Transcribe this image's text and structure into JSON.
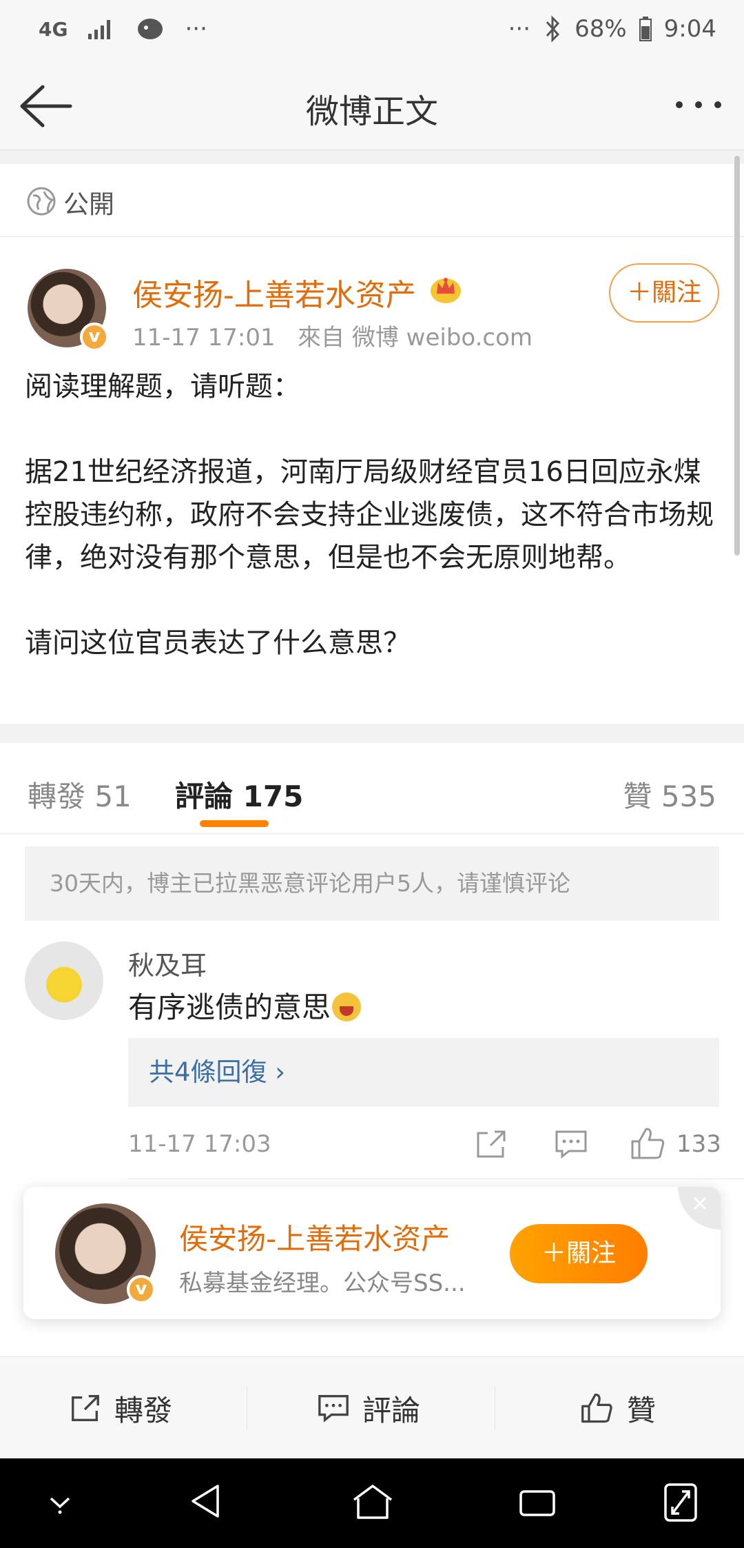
{
  "status_bar": {
    "network": "4G",
    "more_left": "···",
    "more_right": "···",
    "battery": "68%",
    "time": "9:04"
  },
  "nav": {
    "title": "微博正文"
  },
  "visibility": {
    "label": "公開"
  },
  "post": {
    "author": "侯安扬-上善若水资产",
    "verified_badge": "v",
    "timestamp": "11-17 17:01",
    "source": "來自 微博 weibo.com",
    "follow_label": "＋關注",
    "body": "阅读理解题，请听题：\n\n据21世纪经济报道，河南厅局级财经官员16日回应永煤控股违约称，政府不会支持企业逃废债，这不符合市场规律，绝对没有那个意思，但是也不会无原则地帮。\n\n请问这位官员表达了什么意思？"
  },
  "tabs": {
    "repost": "轉發 51",
    "comment": "評論 175",
    "like": "贊 535"
  },
  "comments": {
    "notice": "30天内，博主已拉黑恶意评论用户5人，请谨慎评论",
    "items": [
      {
        "name": "秋及耳",
        "text": "有序逃债的意思",
        "replies": "共4條回復 ›",
        "time": "11-17 17:03",
        "likes": "133"
      }
    ]
  },
  "follow_card": {
    "name": "侯安扬-上善若水资产",
    "desc": "私募基金经理。公众号SS...",
    "follow_label": "＋關注"
  },
  "toolbar": {
    "repost": "轉發",
    "comment": "評論",
    "like": "贊"
  },
  "colors": {
    "accent": "#ff8200",
    "author": "#e36c0a",
    "link": "#3a6ea5"
  }
}
